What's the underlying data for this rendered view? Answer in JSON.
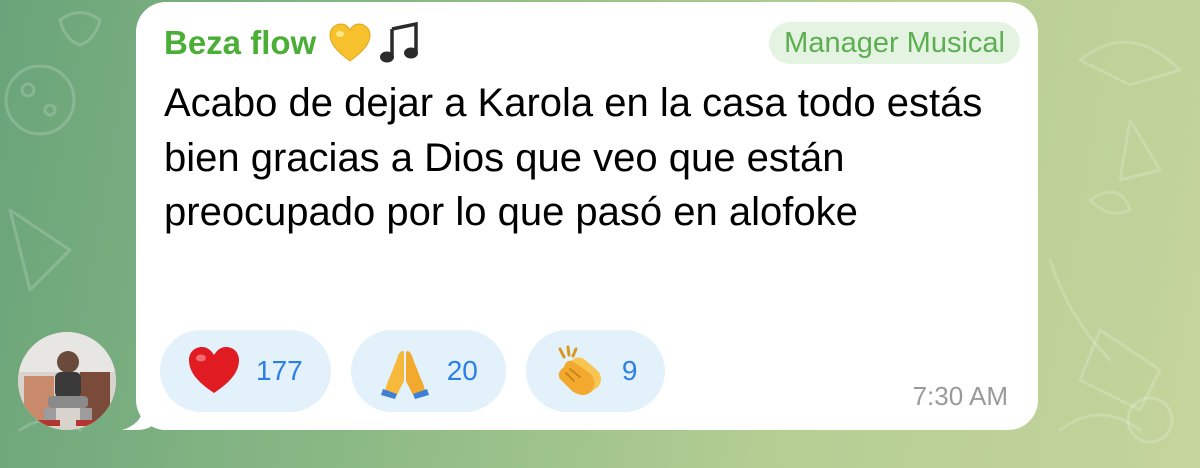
{
  "message": {
    "sender_name": "Beza flow",
    "sender_emoji": [
      "yellow-heart-icon",
      "music-note-icon"
    ],
    "role_badge": "Manager Musical",
    "text": "Acabo de dejar a Karola en la casa todo estás bien gracias a Dios que veo que están preocupado por lo que pasó en alofoke",
    "time": "7:30 AM"
  },
  "reactions": [
    {
      "icon": "red-heart-icon",
      "count": "177"
    },
    {
      "icon": "folded-hands-icon",
      "count": "20"
    },
    {
      "icon": "clapping-hands-icon",
      "count": "9"
    }
  ],
  "colors": {
    "sender_name": "#4bae37",
    "badge_text": "#5cae51",
    "badge_bg": "#e5f4e2",
    "reaction_bg": "#e3f1fb",
    "reaction_count": "#2d7ee6",
    "timestamp": "#9a9a9a"
  }
}
